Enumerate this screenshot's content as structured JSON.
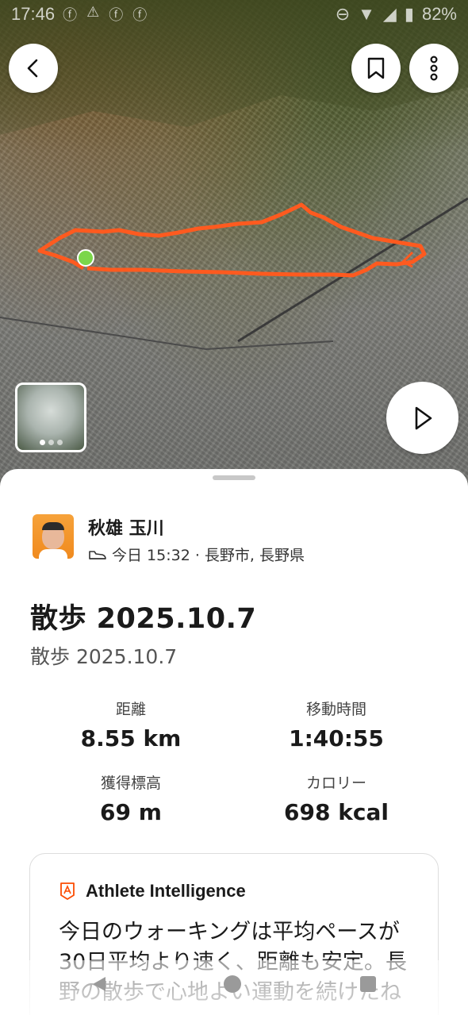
{
  "status_bar": {
    "time": "17:46",
    "battery": "82%",
    "left_icons": [
      "facebook-icon",
      "warning-icon",
      "facebook-icon",
      "facebook-icon"
    ],
    "right_icons": [
      "alarm-icon",
      "wifi-icon",
      "signal-icon",
      "battery-icon"
    ]
  },
  "map": {
    "route_color": "#ff5a1f",
    "start_marker_color": "#7bd64a",
    "photo_count": 3
  },
  "activity": {
    "athlete_name": "秋雄 玉川",
    "meta": "今日 15:32 · 長野市, 長野県",
    "title": "散歩 2025.10.7",
    "subtitle": "散歩 2025.10.7"
  },
  "stats": {
    "distance_label": "距離",
    "distance_value": "8.55 km",
    "moving_time_label": "移動時間",
    "moving_time_value": "1:40:55",
    "elevation_label": "獲得標高",
    "elevation_value": "69 m",
    "calories_label": "カロリー",
    "calories_value": "698 kcal"
  },
  "athlete_intelligence": {
    "title": "Athlete Intelligence",
    "text": "今日のウォーキングは平均ペースが30日平均より速く、距離も安定。長野の散歩で心地よい運動を続けたね"
  },
  "colors": {
    "accent": "#fc4c02",
    "text": "#1a1a1a"
  }
}
